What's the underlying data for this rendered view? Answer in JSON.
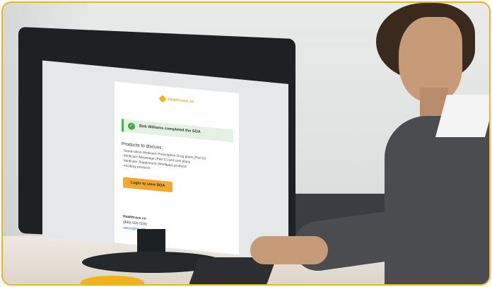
{
  "email": {
    "logo_text": "Healthcare co",
    "banner_text": "Bob Williams completed the SOA",
    "products_title": "Products to discuss:",
    "products": [
      "- Stand-alone Medicare Prescription Drug plans (Part D)",
      "- Medicare Advantage (Part C) and cost plans",
      "- Medicare Supplement (Medigap) products",
      "- Ancillary products"
    ],
    "login_button": "Login to view SOA",
    "footer_name": "Healthcare co",
    "footer_phone": "(800) 555-5555",
    "footer_email": "askus@Healthcareco.com"
  },
  "colors": {
    "accent": "#f2b21b",
    "button": "#f0a82f",
    "success": "#41a843",
    "link": "#2a6db5"
  }
}
